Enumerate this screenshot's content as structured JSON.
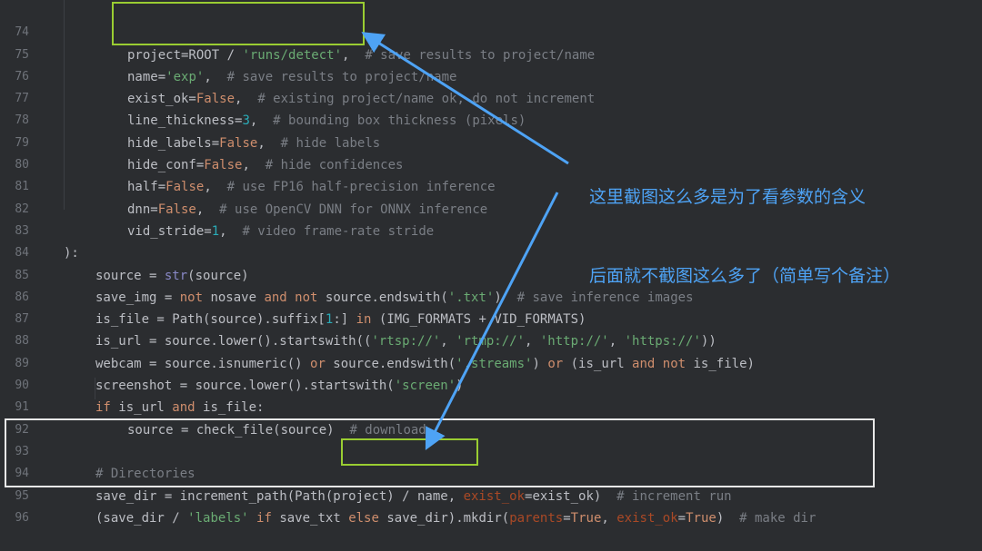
{
  "gutter": {
    "line_numbers": [
      "74",
      "75",
      "76",
      "77",
      "78",
      "79",
      "80",
      "81",
      "82",
      "83",
      "84",
      "85",
      "86",
      "87",
      "88",
      "89",
      "90",
      "91",
      "92",
      "93",
      "94",
      "95",
      "96"
    ]
  },
  "code": {
    "l74": {
      "a": "project=ROOT / ",
      "b": "'runs/detect'",
      "c": ",  ",
      "d": "# save results to project/name"
    },
    "l75": {
      "a": "name=",
      "b": "'exp'",
      "c": ",  ",
      "d": "# save results to project/name"
    },
    "l76": {
      "a": "exist_ok=",
      "b": "False",
      "c": ",  ",
      "d": "# existing project/name ok, do not increment"
    },
    "l77": {
      "a": "line_thickness=",
      "b": "3",
      "c": ",  ",
      "d": "# bounding box thickness (pixels)"
    },
    "l78": {
      "a": "hide_labels=",
      "b": "False",
      "c": ",  ",
      "d": "# hide labels"
    },
    "l79": {
      "a": "hide_conf=",
      "b": "False",
      "c": ",  ",
      "d": "# hide confidences"
    },
    "l80": {
      "a": "half=",
      "b": "False",
      "c": ",  ",
      "d": "# use FP16 half-precision inference"
    },
    "l81": {
      "a": "dnn=",
      "b": "False",
      "c": ",  ",
      "d": "# use OpenCV DNN for ONNX inference"
    },
    "l82": {
      "a": "vid_stride=",
      "b": "1",
      "c": ",  ",
      "d": "# video frame-rate stride"
    },
    "l83": {
      "a": "):"
    },
    "l84": {
      "a": "source = ",
      "b": "str",
      "c": "(source)"
    },
    "l85": {
      "a": "save_img = ",
      "k1": "not",
      "b": " nosave ",
      "k2": "and",
      "k3": " not",
      "c": " source.endswith(",
      "s": "'.txt'",
      "d": ")  ",
      "e": "# save inference images"
    },
    "l86": {
      "a": "is_file = Path(source).suffix[",
      "n": "1",
      "b": ":] ",
      "k": "in",
      "c": " (IMG_FORMATS + VID_FORMATS)"
    },
    "l87": {
      "a": "is_url = source.lower().startswith((",
      "s1": "'rtsp://'",
      "c1": ", ",
      "s2": "'rtmp://'",
      "c2": ", ",
      "s3": "'http://'",
      "c3": ", ",
      "s4": "'https://'",
      "d": "))"
    },
    "l88": {
      "a": "webcam = source.isnumeric() ",
      "k1": "or",
      "b": " source.endswith(",
      "s": "'.streams'",
      "c": ") ",
      "k2": "or",
      "d": " (is_url ",
      "k3": "and",
      "k4": " not",
      "e": " is_file)"
    },
    "l89": {
      "a": "screenshot = source.lower().startswith(",
      "s": "'screen'",
      "b": ")"
    },
    "l90": {
      "k1": "if",
      "a": " is_url ",
      "k2": "and",
      "b": " is_file:"
    },
    "l91": {
      "a": "source = check_file(source)  ",
      "c": "# download"
    },
    "l93": {
      "c": "# Directories"
    },
    "l94": {
      "a": "save_dir = increment_path(Path(project) / name, ",
      "p": "exist_ok",
      "b": "=exist_ok)  ",
      "c": "# increment run"
    },
    "l95": {
      "a": "(save_dir / ",
      "s": "'labels'",
      "k1": " if",
      "b": " save_txt ",
      "k2": "else",
      "c": " save_dir).mkdir(",
      "p1": "parents",
      "e1": "=",
      "t1": "True",
      "c2": ", ",
      "p2": "exist_ok",
      "e2": "=",
      "t2": "True",
      "d": ")  ",
      "cm": "# make dir"
    }
  },
  "annotation": {
    "line1": "这里截图这么多是为了看参数的含义",
    "line2": "后面就不截图这么多了（简单写个备注）"
  },
  "colors": {
    "background": "#2b2d30",
    "keyword": "#cf8e6d",
    "string": "#6aab73",
    "number": "#2aacb8",
    "comment": "#7a7e85",
    "annotation": "#4ea3f5",
    "highlight_box": "#9acd32",
    "region_box": "#e8e8e8"
  }
}
